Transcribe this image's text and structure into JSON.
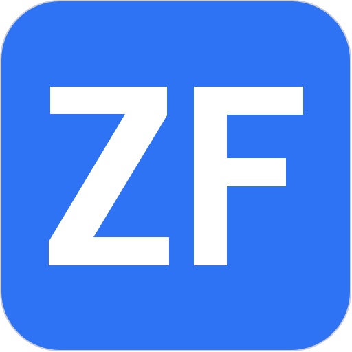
{
  "icon": {
    "name": "app-icon",
    "monogram": "ZF",
    "background_color": "#2f73f5",
    "letter_color": "#ffffff",
    "border_color": "#c9ccd2"
  }
}
